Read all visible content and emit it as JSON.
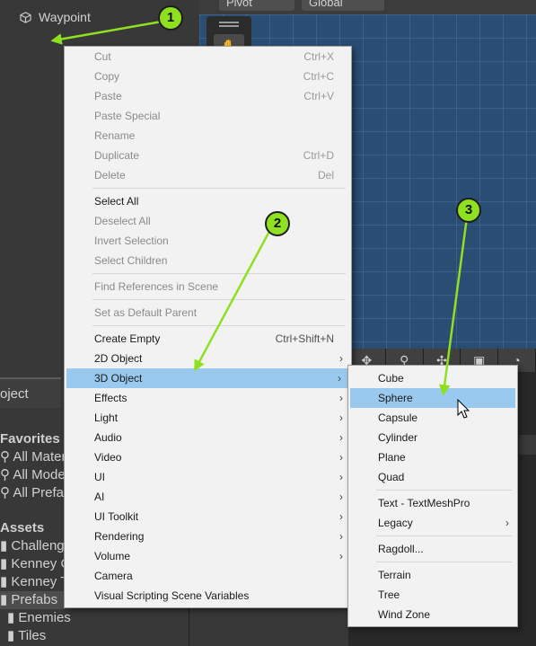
{
  "hierarchy": {
    "item": "Waypoint"
  },
  "scene_toolbar": {
    "pivot": "Pivot",
    "global": "Global"
  },
  "project_panel": {
    "tab": "oject",
    "lines": [
      "Favorites",
      "All Mater",
      "All Mode",
      "All Prefa",
      "Assets",
      "Challeng",
      "Kenney C",
      "Kenney T",
      "Prefabs",
      "Enemies",
      "Tiles"
    ]
  },
  "main_menu": {
    "groups": [
      [
        {
          "label": "Cut",
          "shortcut": "Ctrl+X",
          "enabled": false
        },
        {
          "label": "Copy",
          "shortcut": "Ctrl+C",
          "enabled": false
        },
        {
          "label": "Paste",
          "shortcut": "Ctrl+V",
          "enabled": false
        },
        {
          "label": "Paste Special",
          "shortcut": "",
          "enabled": false
        },
        {
          "label": "Rename",
          "shortcut": "",
          "enabled": false
        },
        {
          "label": "Duplicate",
          "shortcut": "Ctrl+D",
          "enabled": false
        },
        {
          "label": "Delete",
          "shortcut": "Del",
          "enabled": false
        }
      ],
      [
        {
          "label": "Select All",
          "shortcut": "",
          "enabled": true
        },
        {
          "label": "Deselect All",
          "shortcut": "",
          "enabled": false
        },
        {
          "label": "Invert Selection",
          "shortcut": "",
          "enabled": false
        },
        {
          "label": "Select Children",
          "shortcut": "",
          "enabled": false
        }
      ],
      [
        {
          "label": "Find References in Scene",
          "shortcut": "",
          "enabled": false
        }
      ],
      [
        {
          "label": "Set as Default Parent",
          "shortcut": "",
          "enabled": false
        }
      ],
      [
        {
          "label": "Create Empty",
          "shortcut": "Ctrl+Shift+N",
          "enabled": true
        },
        {
          "label": "2D Object",
          "submenu": true,
          "enabled": true
        },
        {
          "label": "3D Object",
          "submenu": true,
          "enabled": true,
          "highlighted": true
        },
        {
          "label": "Effects",
          "submenu": true,
          "enabled": true
        },
        {
          "label": "Light",
          "submenu": true,
          "enabled": true
        },
        {
          "label": "Audio",
          "submenu": true,
          "enabled": true
        },
        {
          "label": "Video",
          "submenu": true,
          "enabled": true
        },
        {
          "label": "UI",
          "submenu": true,
          "enabled": true
        },
        {
          "label": "AI",
          "submenu": true,
          "enabled": true
        },
        {
          "label": "UI Toolkit",
          "submenu": true,
          "enabled": true
        },
        {
          "label": "Rendering",
          "submenu": true,
          "enabled": true
        },
        {
          "label": "Volume",
          "submenu": true,
          "enabled": true
        },
        {
          "label": "Camera",
          "enabled": true
        },
        {
          "label": "Visual Scripting Scene Variables",
          "enabled": true
        }
      ]
    ]
  },
  "sub_menu": {
    "groups": [
      [
        {
          "label": "Cube"
        },
        {
          "label": "Sphere",
          "highlighted": true
        },
        {
          "label": "Capsule"
        },
        {
          "label": "Cylinder"
        },
        {
          "label": "Plane"
        },
        {
          "label": "Quad"
        }
      ],
      [
        {
          "label": "Text - TextMeshPro"
        },
        {
          "label": "Legacy",
          "submenu": true
        }
      ],
      [
        {
          "label": "Ragdoll..."
        }
      ],
      [
        {
          "label": "Terrain"
        },
        {
          "label": "Tree"
        },
        {
          "label": "Wind Zone"
        }
      ]
    ]
  },
  "annotations": {
    "badges": [
      "1",
      "2",
      "3"
    ],
    "arrow_color": "#8fe021"
  },
  "colors": {
    "menu_bg": "#f2f2f2",
    "highlight": "#99c9ef",
    "scene_bg": "#2a4d74",
    "editor_bg": "#383838"
  }
}
